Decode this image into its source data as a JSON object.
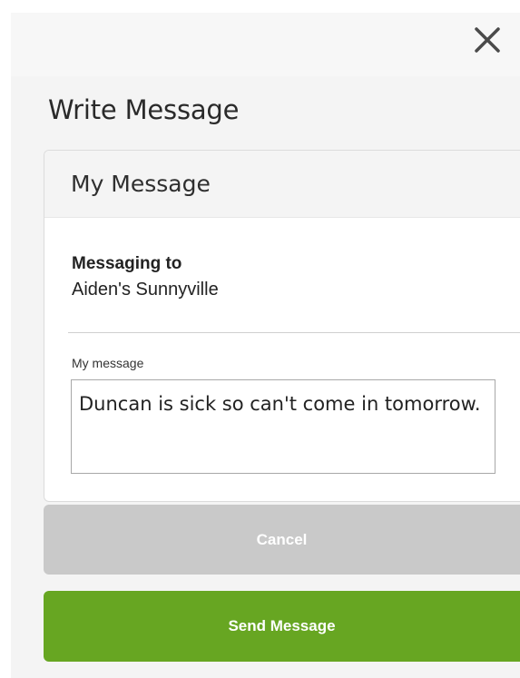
{
  "header": {
    "close_icon": "close-icon"
  },
  "page": {
    "title": "Write Message"
  },
  "card": {
    "title": "My Message",
    "messaging_to_label": "Messaging to",
    "messaging_to_value": "Aiden's Sunnyville",
    "message_label": "My message",
    "message_value": "Duncan is sick so can't come in tomorrow."
  },
  "actions": {
    "cancel_label": "Cancel",
    "send_label": "Send Message"
  },
  "colors": {
    "send_button": "#67a622",
    "cancel_button": "#c9c9c9",
    "background": "#f4f4f4"
  }
}
